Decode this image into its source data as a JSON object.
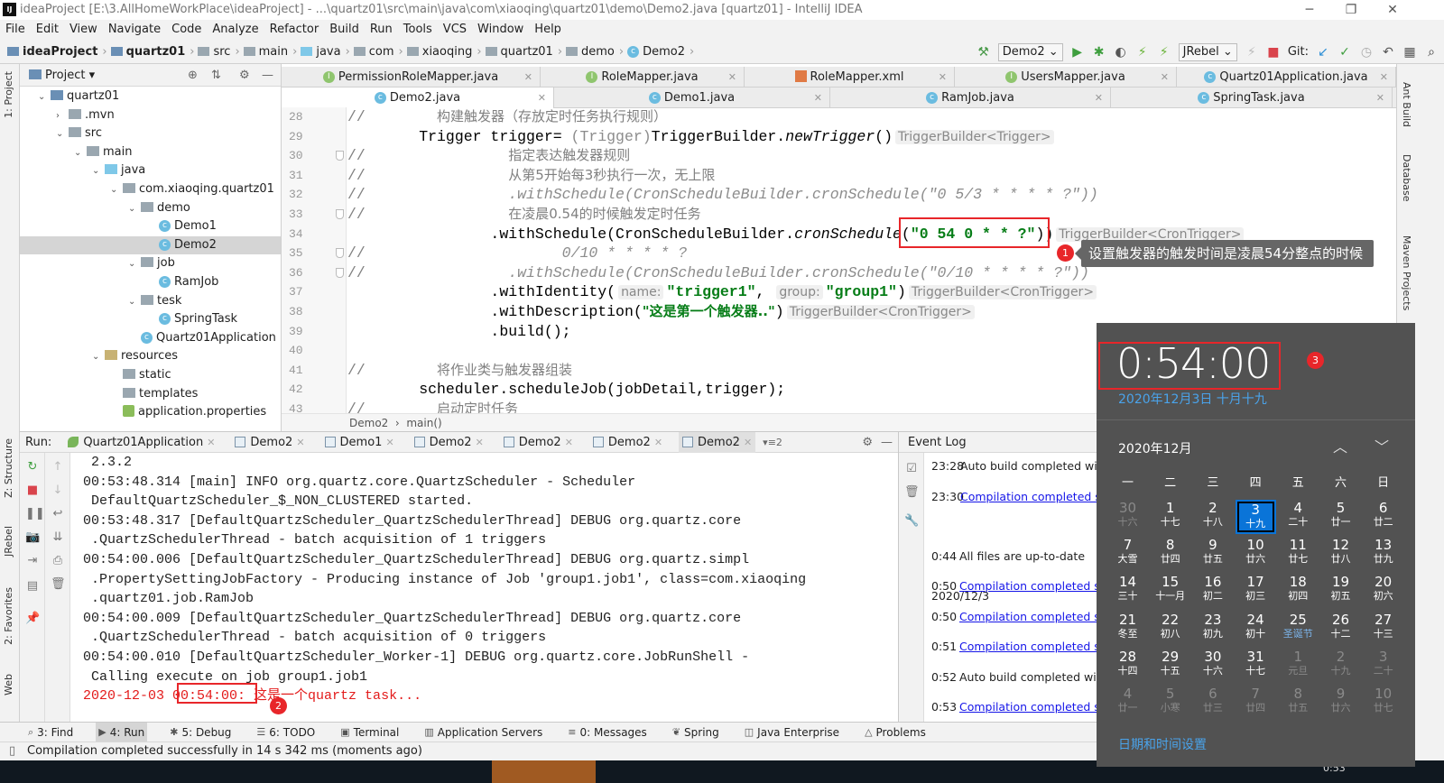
{
  "window": {
    "title": "ideaProject [E:\\3.AllHomeWorkPlace\\ideaProject] - ...\\quartz01\\src\\main\\java\\com\\xiaoqing\\quartz01\\demo\\Demo2.java [quartz01] - IntelliJ IDEA",
    "logo": "IJ"
  },
  "menu": [
    "File",
    "Edit",
    "View",
    "Navigate",
    "Code",
    "Analyze",
    "Refactor",
    "Build",
    "Run",
    "Tools",
    "VCS",
    "Window",
    "Help"
  ],
  "breadcrumbs": [
    {
      "label": "ideaProject",
      "icon": "module-folder",
      "bold": true
    },
    {
      "label": "quartz01",
      "icon": "module-folder",
      "bold": true
    },
    {
      "label": "src",
      "icon": "folder"
    },
    {
      "label": "main",
      "icon": "folder"
    },
    {
      "label": "java",
      "icon": "source-folder"
    },
    {
      "label": "com",
      "icon": "package"
    },
    {
      "label": "xiaoqing",
      "icon": "package"
    },
    {
      "label": "quartz01",
      "icon": "package"
    },
    {
      "label": "demo",
      "icon": "package"
    },
    {
      "label": "Demo2",
      "icon": "class"
    }
  ],
  "toolbar": {
    "run_config": "Demo2",
    "jrebel": "JRebel",
    "git_label": "Git:"
  },
  "left_stripe": [
    "1: Project",
    "Z: Structure",
    "JRebel",
    "2: Favorites",
    "Web"
  ],
  "right_stripe": [
    "Ant Build",
    "Database",
    "Maven Projects"
  ],
  "project": {
    "title": "Project",
    "tree": [
      {
        "label": "quartz01",
        "depth": 0,
        "arrow": "▼",
        "icon": "mod"
      },
      {
        "label": ".mvn",
        "depth": 1,
        "arrow": "▶",
        "icon": "folder"
      },
      {
        "label": "src",
        "depth": 1,
        "arrow": "▼",
        "icon": "folder"
      },
      {
        "label": "main",
        "depth": 2,
        "arrow": "▼",
        "icon": "folder"
      },
      {
        "label": "java",
        "depth": 3,
        "arrow": "▼",
        "icon": "src"
      },
      {
        "label": "com.xiaoqing.quartz01",
        "depth": 4,
        "arrow": "▼",
        "icon": "folder"
      },
      {
        "label": "demo",
        "depth": 5,
        "arrow": "▼",
        "icon": "folder"
      },
      {
        "label": "Demo1",
        "depth": 6,
        "arrow": "",
        "icon": "class"
      },
      {
        "label": "Demo2",
        "depth": 6,
        "arrow": "",
        "icon": "class",
        "selected": true
      },
      {
        "label": "job",
        "depth": 5,
        "arrow": "▼",
        "icon": "folder"
      },
      {
        "label": "RamJob",
        "depth": 6,
        "arrow": "",
        "icon": "class"
      },
      {
        "label": "tesk",
        "depth": 5,
        "arrow": "▼",
        "icon": "folder"
      },
      {
        "label": "SpringTask",
        "depth": 6,
        "arrow": "",
        "icon": "class"
      },
      {
        "label": "Quartz01Application",
        "depth": 5,
        "arrow": "",
        "icon": "class"
      },
      {
        "label": "resources",
        "depth": 3,
        "arrow": "▼",
        "icon": "res"
      },
      {
        "label": "static",
        "depth": 4,
        "arrow": "",
        "icon": "folder"
      },
      {
        "label": "templates",
        "depth": 4,
        "arrow": "",
        "icon": "folder"
      },
      {
        "label": "application.properties",
        "depth": 4,
        "arrow": "",
        "icon": "prop"
      }
    ]
  },
  "editor": {
    "tabs_row1": [
      {
        "label": "PermissionRoleMapper.java",
        "icon": "interface"
      },
      {
        "label": "RoleMapper.java",
        "icon": "interface"
      },
      {
        "label": "RoleMapper.xml",
        "icon": "xml"
      },
      {
        "label": "UsersMapper.java",
        "icon": "interface"
      },
      {
        "label": "Quartz01Application.java",
        "icon": "class"
      }
    ],
    "tabs_row2": [
      {
        "label": "Demo2.java",
        "icon": "class",
        "active": true
      },
      {
        "label": "Demo1.java",
        "icon": "class"
      },
      {
        "label": "RamJob.java",
        "icon": "class"
      },
      {
        "label": "SpringTask.java",
        "icon": "class"
      }
    ],
    "lines": [
      {
        "n": "28",
        "fold": false,
        "segs": [
          {
            "c": "cm",
            "t": "//        "
          },
          {
            "c": "zh",
            "t": "构建触发器（存放定时任务执行规则）"
          }
        ]
      },
      {
        "n": "29",
        "fold": false,
        "segs": [
          {
            "c": "",
            "t": "        Trigger trigger= "
          },
          {
            "c": "g",
            "t": "(Trigger)"
          },
          {
            "c": "",
            "t": "TriggerBuilder."
          },
          {
            "c": "it",
            "t": "newTrigger"
          },
          {
            "c": "",
            "t": "()"
          },
          {
            "c": "h",
            "t": "TriggerBuilder<Trigger>"
          }
        ]
      },
      {
        "n": "30",
        "fold": true,
        "segs": [
          {
            "c": "cm",
            "t": "//                "
          },
          {
            "c": "zh",
            "t": "指定表达触发器规则"
          }
        ]
      },
      {
        "n": "31",
        "fold": false,
        "segs": [
          {
            "c": "cm",
            "t": "//                "
          },
          {
            "c": "zh",
            "t": "从第5开始每3秒执行一次，无上限"
          }
        ]
      },
      {
        "n": "32",
        "fold": false,
        "segs": [
          {
            "c": "cm",
            "t": "//                "
          },
          {
            "c": "cmi",
            "t": ".withSchedule(CronScheduleBuilder.cronSchedule(\"0 5/3 * * * * ?\"))"
          }
        ]
      },
      {
        "n": "33",
        "fold": true,
        "segs": [
          {
            "c": "cm",
            "t": "//                "
          },
          {
            "c": "zh",
            "t": "在凌晨0.54的时候触发定时任务"
          }
        ]
      },
      {
        "n": "34",
        "fold": false,
        "segs": [
          {
            "c": "",
            "t": "                .withSchedule(CronScheduleBuilder."
          },
          {
            "c": "it",
            "t": "cronSchedule"
          },
          {
            "c": "",
            "t": "("
          },
          {
            "c": "s",
            "t": "\"0 54 0 * * ?\""
          },
          {
            "c": "",
            "t": "))"
          },
          {
            "c": "h",
            "t": "TriggerBuilder<CronTrigger>"
          }
        ]
      },
      {
        "n": "35",
        "fold": true,
        "segs": [
          {
            "c": "cm",
            "t": "//                      "
          },
          {
            "c": "cmi",
            "t": "0/10 * * * * ?"
          }
        ]
      },
      {
        "n": "36",
        "fold": true,
        "segs": [
          {
            "c": "cm",
            "t": "//                "
          },
          {
            "c": "cmi",
            "t": ".withSchedule(CronScheduleBuilder.cronSchedule(\"0/10 * * * * ?\"))"
          }
        ]
      },
      {
        "n": "37",
        "fold": false,
        "segs": [
          {
            "c": "",
            "t": "                .withIdentity("
          },
          {
            "c": "h",
            "t": "name:"
          },
          {
            "c": "s",
            "t": "\"trigger1\""
          },
          {
            "c": "",
            "t": ", "
          },
          {
            "c": "h",
            "t": "group:"
          },
          {
            "c": "s",
            "t": "\"group1\""
          },
          {
            "c": "",
            "t": ")"
          },
          {
            "c": "h",
            "t": "TriggerBuilder<CronTrigger>"
          }
        ]
      },
      {
        "n": "38",
        "fold": false,
        "segs": [
          {
            "c": "",
            "t": "                .withDescription("
          },
          {
            "c": "szh",
            "t": "\"这是第一个触发器..\""
          },
          {
            "c": "",
            "t": ")"
          },
          {
            "c": "h",
            "t": "TriggerBuilder<CronTrigger>"
          }
        ]
      },
      {
        "n": "39",
        "fold": false,
        "segs": [
          {
            "c": "",
            "t": "                .build();"
          }
        ]
      },
      {
        "n": "40",
        "fold": false,
        "segs": [
          {
            "c": "",
            "t": ""
          }
        ]
      },
      {
        "n": "41",
        "fold": false,
        "segs": [
          {
            "c": "cm",
            "t": "//        "
          },
          {
            "c": "zh",
            "t": "将作业类与触发器组装"
          }
        ]
      },
      {
        "n": "42",
        "fold": false,
        "segs": [
          {
            "c": "",
            "t": "        scheduler.scheduleJob(jobDetail,trigger);"
          }
        ]
      },
      {
        "n": "43",
        "fold": false,
        "segs": [
          {
            "c": "cm",
            "t": "//        "
          },
          {
            "c": "zh",
            "t": "启动定时任务"
          }
        ]
      }
    ],
    "breadcrumb": [
      "Demo2",
      "main()"
    ]
  },
  "annotations": {
    "badge1": "1",
    "badge2": "2",
    "badge3": "3",
    "tooltip": "设置触发器的触发时间是凌晨54分整点的时候"
  },
  "run": {
    "label": "Run:",
    "tabs": [
      {
        "label": "Quartz01Application",
        "icon": "spring"
      },
      {
        "label": "Demo2"
      },
      {
        "label": "Demo1"
      },
      {
        "label": "Demo2"
      },
      {
        "label": "Demo2"
      },
      {
        "label": "Demo2"
      },
      {
        "label": "Demo2",
        "active": true
      }
    ],
    "overflow": "▾≡2",
    "console": [
      " 2.3.2",
      "00:53:48.314 [main] INFO org.quartz.core.QuartzScheduler - Scheduler",
      " DefaultQuartzScheduler_$_NON_CLUSTERED started.",
      "00:53:48.317 [DefaultQuartzScheduler_QuartzSchedulerThread] DEBUG org.quartz.core",
      " .QuartzSchedulerThread - batch acquisition of 1 triggers",
      "00:54:00.006 [DefaultQuartzScheduler_QuartzSchedulerThread] DEBUG org.quartz.simpl",
      " .PropertySettingJobFactory - Producing instance of Job 'group1.job1', class=com.xiaoqing",
      " .quartz01.job.RamJob",
      "00:54:00.009 [DefaultQuartzScheduler_QuartzSchedulerThread] DEBUG org.quartz.core",
      " .QuartzSchedulerThread - batch acquisition of 0 triggers",
      "00:54:00.010 [DefaultQuartzScheduler_Worker-1] DEBUG org.quartz.core.JobRunShell -",
      " Calling execute on job group1.job1"
    ],
    "last_line": {
      "date": "2020-12-03 ",
      "time": "00:54:00",
      "rest": ": 这是一个quartz task..."
    }
  },
  "event_log": {
    "title": "Event Log",
    "entries": [
      {
        "time": "23:28",
        "text": "Auto build completed with",
        "link": false
      },
      {
        "time": "23:30",
        "text": "Compilation completed su",
        "link": true
      },
      {
        "date": "2020/12/3",
        "time": "0:44",
        "text": "All files are up-to-date",
        "link": false
      },
      {
        "time": "0:50",
        "text": "Compilation completed su",
        "link": true
      },
      {
        "time": "0:50",
        "text": "Compilation completed su",
        "link": true
      },
      {
        "time": "0:51",
        "text": "Compilation completed su",
        "link": true
      },
      {
        "time": "0:52",
        "text": "Auto build completed with",
        "link": false
      },
      {
        "time": "0:53",
        "text": "Compilation completed su",
        "link": true
      }
    ]
  },
  "tool_windows": [
    {
      "label": "3: Find",
      "icon": "search"
    },
    {
      "label": "4: Run",
      "icon": "run",
      "active": true
    },
    {
      "label": "5: Debug",
      "icon": "bug"
    },
    {
      "label": "6: TODO",
      "icon": "list"
    },
    {
      "label": "Terminal",
      "icon": "terminal"
    },
    {
      "label": "Application Servers",
      "icon": "server"
    },
    {
      "label": "0: Messages",
      "icon": "messages"
    },
    {
      "label": "Spring",
      "icon": "spring"
    },
    {
      "label": "Java Enterprise",
      "icon": "javaee"
    },
    {
      "label": "Problems",
      "icon": "warning"
    }
  ],
  "status": "Compilation completed successfully in 14 s 342 ms (moments ago)",
  "calendar": {
    "time": "0:54:00",
    "date": "2020年12月3日 十月十九",
    "month": "2020年12月",
    "weekdays": [
      "一",
      "二",
      "三",
      "四",
      "五",
      "六",
      "日"
    ],
    "days": [
      {
        "d": "30",
        "l": "十六",
        "dim": true
      },
      {
        "d": "1",
        "l": "十七"
      },
      {
        "d": "2",
        "l": "十八"
      },
      {
        "d": "3",
        "l": "十九",
        "today": true
      },
      {
        "d": "4",
        "l": "二十"
      },
      {
        "d": "5",
        "l": "廿一"
      },
      {
        "d": "6",
        "l": "廿二"
      },
      {
        "d": "7",
        "l": "大雪"
      },
      {
        "d": "8",
        "l": "廿四"
      },
      {
        "d": "9",
        "l": "廿五"
      },
      {
        "d": "10",
        "l": "廿六"
      },
      {
        "d": "11",
        "l": "廿七"
      },
      {
        "d": "12",
        "l": "廿八"
      },
      {
        "d": "13",
        "l": "廿九"
      },
      {
        "d": "14",
        "l": "三十"
      },
      {
        "d": "15",
        "l": "十一月"
      },
      {
        "d": "16",
        "l": "初二"
      },
      {
        "d": "17",
        "l": "初三"
      },
      {
        "d": "18",
        "l": "初四"
      },
      {
        "d": "19",
        "l": "初五"
      },
      {
        "d": "20",
        "l": "初六"
      },
      {
        "d": "21",
        "l": "冬至"
      },
      {
        "d": "22",
        "l": "初八"
      },
      {
        "d": "23",
        "l": "初九"
      },
      {
        "d": "24",
        "l": "初十"
      },
      {
        "d": "25",
        "l": "圣诞节",
        "holiday": true
      },
      {
        "d": "26",
        "l": "十二"
      },
      {
        "d": "27",
        "l": "十三"
      },
      {
        "d": "28",
        "l": "十四"
      },
      {
        "d": "29",
        "l": "十五"
      },
      {
        "d": "30",
        "l": "十六"
      },
      {
        "d": "31",
        "l": "十七"
      },
      {
        "d": "1",
        "l": "元旦",
        "dim": true
      },
      {
        "d": "2",
        "l": "十九",
        "dim": true
      },
      {
        "d": "3",
        "l": "二十",
        "dim": true
      },
      {
        "d": "4",
        "l": "廿一",
        "dim": true
      },
      {
        "d": "5",
        "l": "小寒",
        "dim": true
      },
      {
        "d": "6",
        "l": "廿三",
        "dim": true
      },
      {
        "d": "7",
        "l": "廿四",
        "dim": true
      },
      {
        "d": "8",
        "l": "廿五",
        "dim": true
      },
      {
        "d": "9",
        "l": "廿六",
        "dim": true
      },
      {
        "d": "10",
        "l": "廿七",
        "dim": true
      }
    ],
    "settings_link": "日期和时间设置",
    "taskbar_clock": "0:53"
  },
  "colors": {
    "accent": "#0a74d8",
    "annotation": "#e8262a",
    "string": "#067d17",
    "link": "#1515e8"
  }
}
